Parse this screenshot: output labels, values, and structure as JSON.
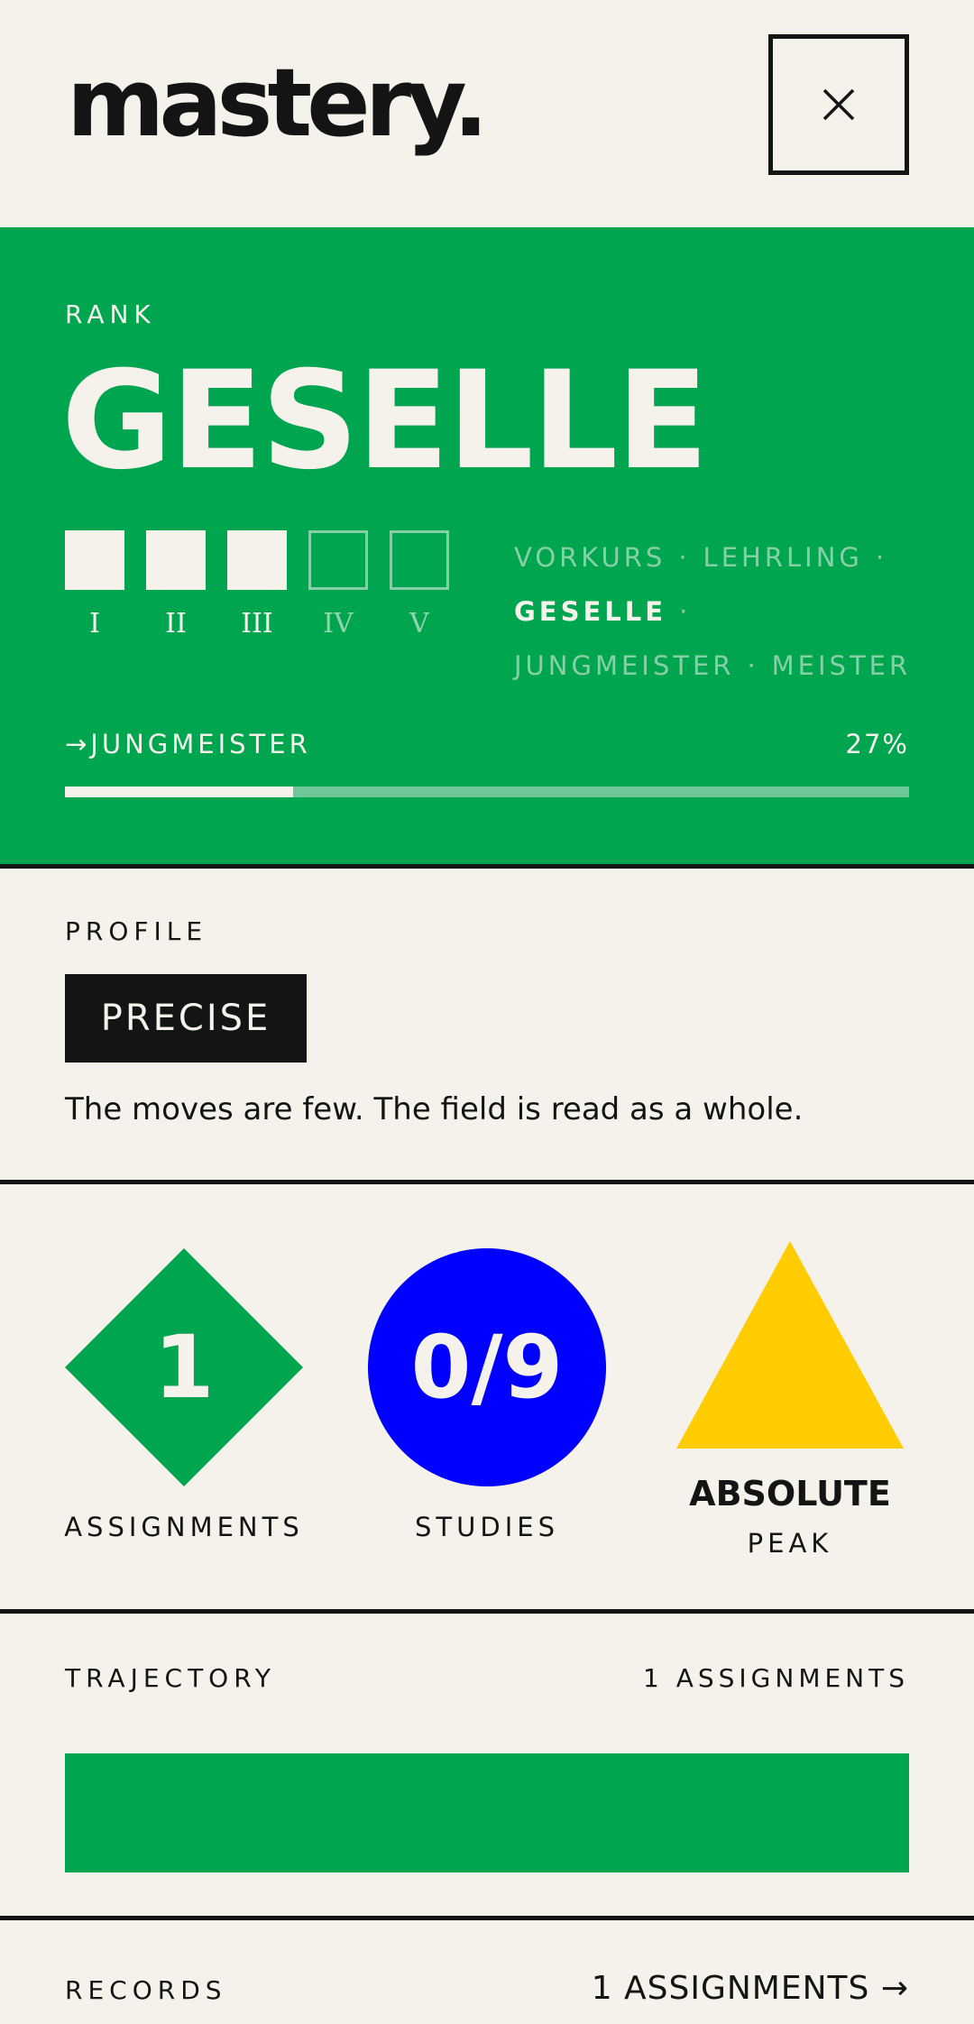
{
  "header": {
    "logo": "mastery.",
    "close_icon": "close-icon"
  },
  "rank": {
    "section_label": "RANK",
    "current_rank": "GESELLE",
    "levels": [
      {
        "numeral": "I",
        "filled": true
      },
      {
        "numeral": "II",
        "filled": true
      },
      {
        "numeral": "III",
        "filled": true
      },
      {
        "numeral": "IV",
        "filled": false
      },
      {
        "numeral": "V",
        "filled": false
      }
    ],
    "path": {
      "r1": "VORKURS",
      "r2": "LEHRLING",
      "r3": "GESELLE",
      "r4": "JUNGMEISTER",
      "r5": "MEISTER",
      "separator": "·"
    },
    "next": "→JUNGMEISTER",
    "progress_label": "27%",
    "progress_fraction": 0.27
  },
  "profile": {
    "section_label": "PROFILE",
    "badge": "PRECISE",
    "description": "The moves are few. The field is read as a whole."
  },
  "stats": {
    "assignments": {
      "value": "1",
      "label": "ASSIGNMENTS",
      "shape": "diamond",
      "color": "#00a550"
    },
    "studies": {
      "value": "0/9",
      "label": "STUDIES",
      "shape": "circle",
      "color": "#0000ff"
    },
    "peak": {
      "value": "ABSOLUTE",
      "label": "PEAK",
      "shape": "triangle",
      "color": "#ffcc00"
    }
  },
  "trajectory": {
    "section_label": "TRAJECTORY",
    "count": "1 ASSIGNMENTS",
    "bar_color": "#00a550"
  },
  "records": {
    "section_label": "RECORDS",
    "link": "1 ASSIGNMENTS →"
  },
  "colors": {
    "green": "#00a550",
    "cream": "#f5f2ec",
    "ink": "#141414",
    "blue": "#0000ff",
    "yellow": "#ffcc00"
  }
}
